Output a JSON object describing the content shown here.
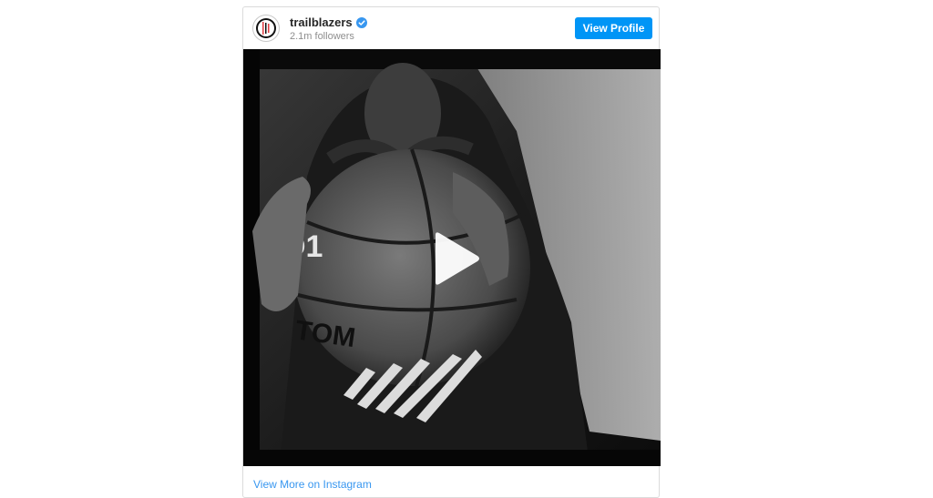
{
  "post": {
    "username": "trailblazers",
    "followers": "2.1m followers",
    "view_profile_label": "View Profile",
    "verified": true,
    "ball_text_1": "D1",
    "ball_text_2": "TOM"
  },
  "footer": {
    "link_label": "View More on Instagram"
  },
  "colors": {
    "button": "#0095f6",
    "link": "#3897f0",
    "username": "#262626",
    "muted": "#8e8e8e"
  },
  "icons": {
    "avatar": "blazers-logo-icon",
    "verified": "verified-badge-icon",
    "play": "play-icon"
  }
}
